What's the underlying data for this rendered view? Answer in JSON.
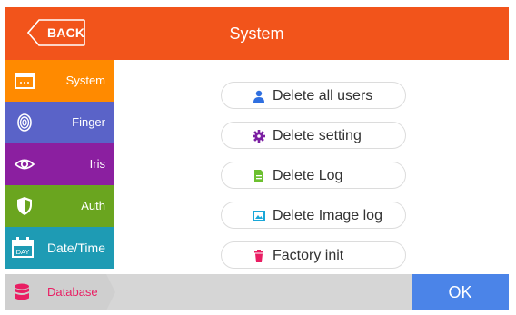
{
  "header": {
    "back_label": "BACK",
    "title": "System",
    "color": "#f2541b"
  },
  "sidebar": {
    "items": [
      {
        "label": "System",
        "icon": "window-icon",
        "color": "#ff8a00"
      },
      {
        "label": "Finger",
        "icon": "fingerprint-icon",
        "color": "#5a63c8"
      },
      {
        "label": "Iris",
        "icon": "eye-icon",
        "color": "#8b1fa0"
      },
      {
        "label": "Auth",
        "icon": "shield-icon",
        "color": "#6aa51f"
      },
      {
        "label": "Date/Time",
        "icon": "calendar-icon",
        "icon_text": "DAY",
        "color": "#1e9bb4"
      }
    ]
  },
  "actions": [
    {
      "label": "Delete all users",
      "icon": "user-icon",
      "color": "#2f6fe0"
    },
    {
      "label": "Delete setting",
      "icon": "gear-icon",
      "color": "#7b1fa2"
    },
    {
      "label": "Delete Log",
      "icon": "document-icon",
      "color": "#6cc02f"
    },
    {
      "label": "Delete Image log",
      "icon": "image-icon",
      "color": "#1aa7d8"
    },
    {
      "label": "Factory init",
      "icon": "trash-icon",
      "color": "#e91e63"
    }
  ],
  "bottom": {
    "database_label": "Database",
    "database_icon": "database-icon",
    "database_color": "#e91e63",
    "ok_label": "OK",
    "ok_color": "#4b84e8"
  }
}
